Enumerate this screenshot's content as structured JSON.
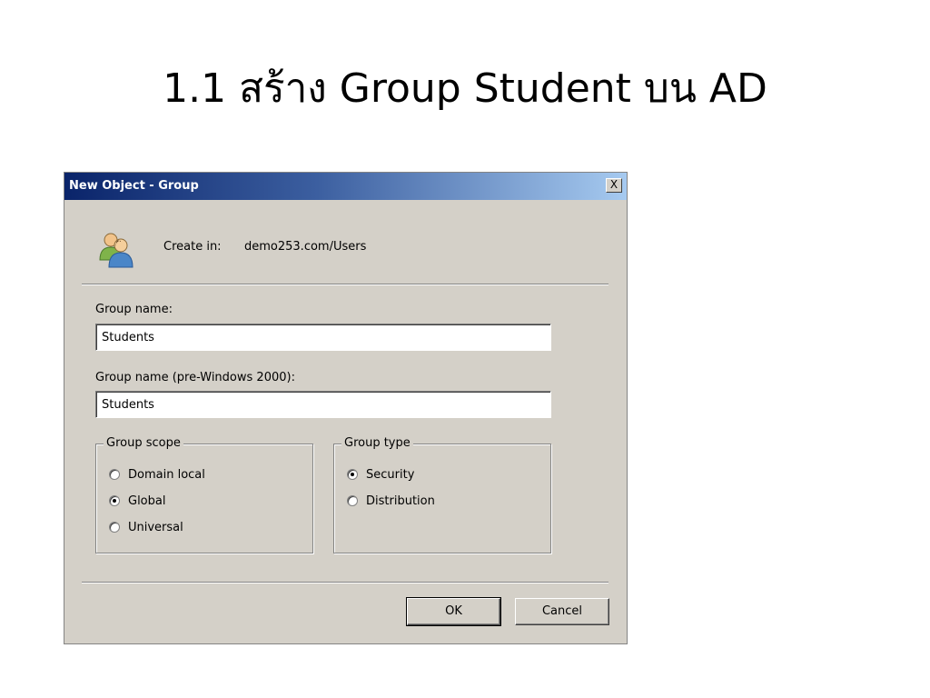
{
  "slide": {
    "title": "1.1 สร้าง Group Student บน AD"
  },
  "dialog": {
    "title": "New Object - Group",
    "close_label": "X",
    "create_in_label": "Create in:",
    "create_in_value": "demo253.com/Users",
    "group_name_label": "Group name:",
    "group_name_value": "Students",
    "group_name_pre2000_label": "Group name (pre-Windows 2000):",
    "group_name_pre2000_value": "Students",
    "group_scope": {
      "legend": "Group scope",
      "options": [
        {
          "label": "Domain local",
          "checked": false
        },
        {
          "label": "Global",
          "checked": true
        },
        {
          "label": "Universal",
          "checked": false
        }
      ]
    },
    "group_type": {
      "legend": "Group type",
      "options": [
        {
          "label": "Security",
          "checked": true
        },
        {
          "label": "Distribution",
          "checked": false
        }
      ]
    },
    "ok_label": "OK",
    "cancel_label": "Cancel"
  },
  "icons": {
    "group": "users-group-icon",
    "close": "close-icon"
  },
  "colors": {
    "titlebar_start": "#0a246a",
    "titlebar_end": "#a6caf0",
    "dialog_bg": "#d4d0c8"
  }
}
